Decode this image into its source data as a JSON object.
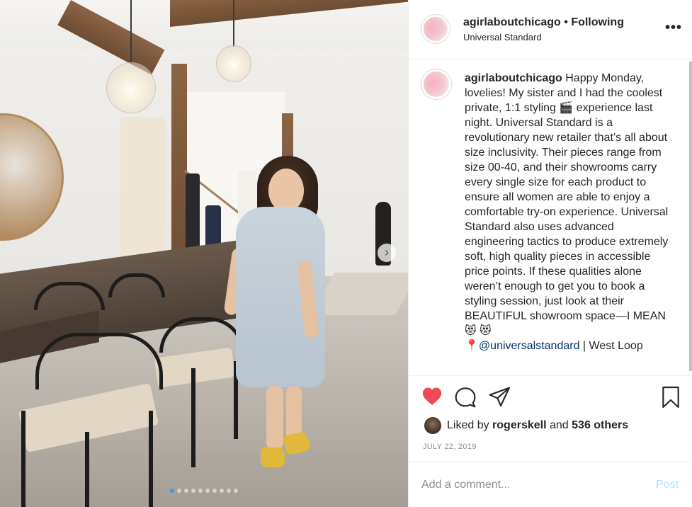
{
  "header": {
    "username": "agirlaboutchicago",
    "separator": "•",
    "follow_status": "Following",
    "location": "Universal Standard",
    "more_label": "•••"
  },
  "caption": {
    "username": "agirlaboutchicago",
    "text_main": "Happy Monday, lovelies! My sister and I had the coolest private, 1:1 styling 🎬 experience last night. Universal Standard is a revolutionary new retailer that’s all about size inclusivity. Their pieces range from size 00-40, and their showrooms carry every single size for each product to ensure all women are able to enjoy a comfortable try-on experience. Universal Standard also uses advanced engineering tactics to produce extremely soft, high quality pieces in accessible price points. If these qualities alone weren’t enough to get you to book a styling session, just look at their BEAUTIFUL showroom space—I MEAN 😻 😻",
    "pin": "📍",
    "mention": "@universalstandard",
    "after_mention": " | West Loop"
  },
  "likes": {
    "prefix": "Liked by",
    "user": "rogerskell",
    "middle": "and",
    "others": "536 others"
  },
  "date": "JULY 22, 2019",
  "comment_input": {
    "placeholder": "Add a comment...",
    "value": ""
  },
  "post_button": "Post",
  "carousel": {
    "slide_count": 10,
    "active_index": 0,
    "next_glyph": "›"
  },
  "colors": {
    "heart_liked": "#ed4956",
    "link": "#003569",
    "carousel_active": "#3897f0",
    "post_disabled": "#b2dffc",
    "secondary_text": "#8e8e8e"
  },
  "icons": [
    "heart-icon",
    "comment-icon",
    "share-icon",
    "bookmark-icon",
    "more-icon",
    "chevron-right-icon"
  ]
}
